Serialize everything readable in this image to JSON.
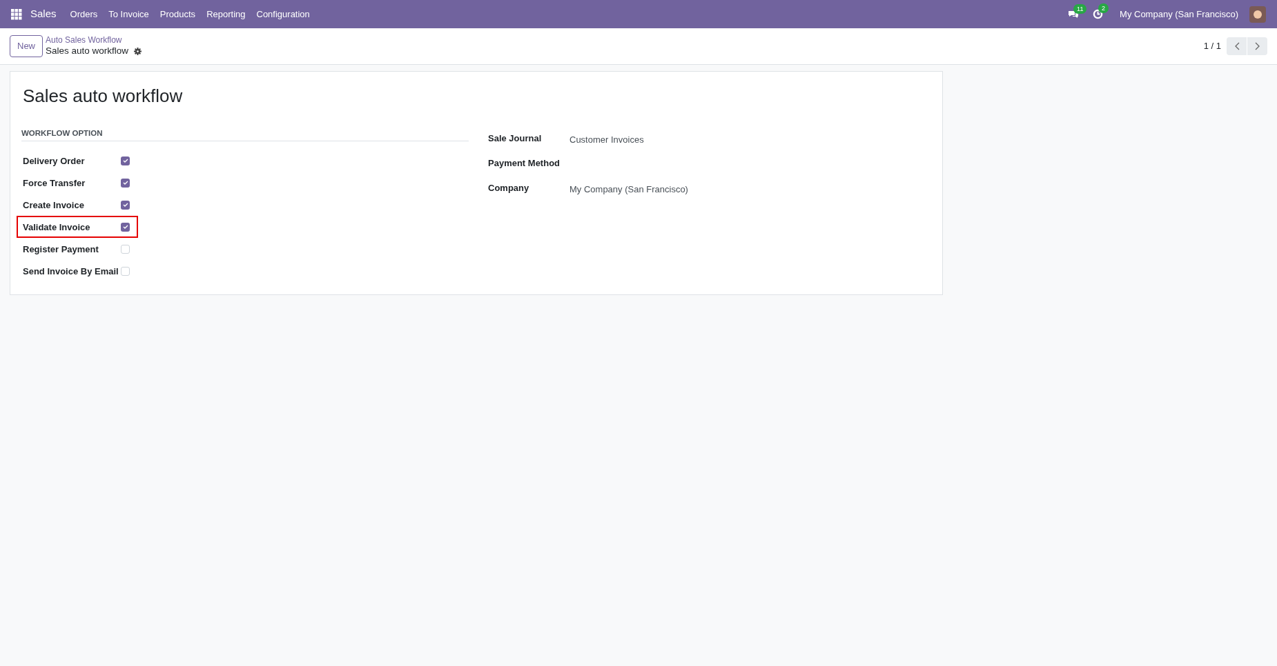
{
  "navbar": {
    "app": "Sales",
    "menu": [
      "Orders",
      "To Invoice",
      "Products",
      "Reporting",
      "Configuration"
    ],
    "messages_badge": "11",
    "activities_badge": "2",
    "company": "My Company (San Francisco)"
  },
  "control_panel": {
    "new_button": "New",
    "breadcrumb": "Auto Sales Workflow",
    "record": "Sales auto workflow",
    "pager": "1 / 1"
  },
  "form": {
    "title": "Sales auto workflow",
    "section": "WORKFLOW OPTION",
    "options": [
      {
        "label": "Delivery Order",
        "checked": true,
        "highlighted": false
      },
      {
        "label": "Force Transfer",
        "checked": true,
        "highlighted": false
      },
      {
        "label": "Create Invoice",
        "checked": true,
        "highlighted": false
      },
      {
        "label": "Validate Invoice",
        "checked": true,
        "highlighted": true
      },
      {
        "label": "Register Payment",
        "checked": false,
        "highlighted": false
      },
      {
        "label": "Send Invoice By Email",
        "checked": false,
        "highlighted": false
      }
    ],
    "fields": [
      {
        "label": "Sale Journal",
        "value": "Customer Invoices"
      },
      {
        "label": "Payment Method"
      },
      {
        "label": "Company",
        "value": "My Company (San Francisco)"
      }
    ]
  }
}
